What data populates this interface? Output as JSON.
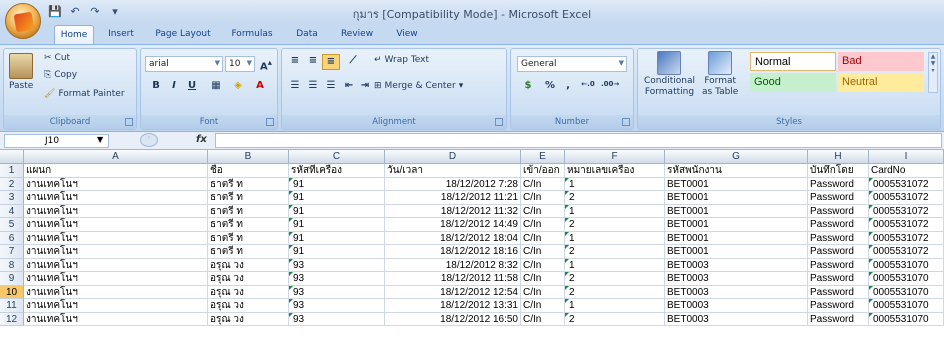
{
  "app": {
    "title": "กุมาร  [Compatibility Mode] - Microsoft Excel"
  },
  "tabs": [
    "Home",
    "Insert",
    "Page Layout",
    "Formulas",
    "Data",
    "Review",
    "View"
  ],
  "ribbon": {
    "clipboard": {
      "label": "Clipboard",
      "paste": "Paste",
      "cut": "Cut",
      "copy": "Copy",
      "format_painter": "Format Painter"
    },
    "font": {
      "label": "Font",
      "name": "arial",
      "size": "10",
      "bold": "B",
      "italic": "I",
      "underline": "U"
    },
    "alignment": {
      "label": "Alignment",
      "wrap_text": "Wrap Text",
      "merge_center": "Merge & Center"
    },
    "number": {
      "label": "Number",
      "format": "General",
      "percent": "%",
      "comma": ","
    },
    "styles": {
      "label": "Styles",
      "conditional": "Conditional",
      "conditional2": "Formatting",
      "format_as": "Format",
      "format_as2": "as Table",
      "normal": "Normal",
      "bad": "Bad",
      "good": "Good",
      "neutral": "Neutral"
    }
  },
  "formula_bar": {
    "name_box": "J10",
    "fx": "fx",
    "value": ""
  },
  "columns": [
    "A",
    "B",
    "C",
    "D",
    "E",
    "F",
    "G",
    "H",
    "I"
  ],
  "rows": [
    {
      "n": "1",
      "cells": [
        "แผนก",
        "ชื่อ",
        "รหัสที่เครื่อง",
        "วัน/เวลา",
        "เข้า/ออก",
        "หมายเลขเครื่อง",
        "รหัสพนักงาน",
        "บันทึกโดย",
        "CardNo"
      ]
    },
    {
      "n": "2",
      "cells": [
        "งานเทคโนฯ",
        "ธาตรี ท",
        "91",
        "18/12/2012 7:28",
        "C/In",
        "1",
        "BET0001",
        "Password",
        "0005531072"
      ]
    },
    {
      "n": "3",
      "cells": [
        "งานเทคโนฯ",
        "ธาตรี ท",
        "91",
        "18/12/2012 11:21",
        "C/In",
        "2",
        "BET0001",
        "Password",
        "0005531072"
      ]
    },
    {
      "n": "4",
      "cells": [
        "งานเทคโนฯ",
        "ธาตรี ท",
        "91",
        "18/12/2012 11:32",
        "C/In",
        "1",
        "BET0001",
        "Password",
        "0005531072"
      ]
    },
    {
      "n": "5",
      "cells": [
        "งานเทคโนฯ",
        "ธาตรี ท",
        "91",
        "18/12/2012 14:49",
        "C/In",
        "2",
        "BET0001",
        "Password",
        "0005531072"
      ]
    },
    {
      "n": "6",
      "cells": [
        "งานเทคโนฯ",
        "ธาตรี ท",
        "91",
        "18/12/2012 18:04",
        "C/In",
        "1",
        "BET0001",
        "Password",
        "0005531072"
      ]
    },
    {
      "n": "7",
      "cells": [
        "งานเทคโนฯ",
        "ธาตรี ท",
        "91",
        "18/12/2012 18:16",
        "C/In",
        "2",
        "BET0001",
        "Password",
        "0005531072"
      ]
    },
    {
      "n": "8",
      "cells": [
        "งานเทคโนฯ",
        "อรุณ วง",
        "93",
        "18/12/2012 8:32",
        "C/In",
        "1",
        "BET0003",
        "Password",
        "0005531070"
      ]
    },
    {
      "n": "9",
      "cells": [
        "งานเทคโนฯ",
        "อรุณ วง",
        "93",
        "18/12/2012 11:58",
        "C/In",
        "2",
        "BET0003",
        "Password",
        "0005531070"
      ]
    },
    {
      "n": "10",
      "cells": [
        "งานเทคโนฯ",
        "อรุณ วง",
        "93",
        "18/12/2012 12:54",
        "C/In",
        "2",
        "BET0003",
        "Password",
        "0005531070"
      ]
    },
    {
      "n": "11",
      "cells": [
        "งานเทคโนฯ",
        "อรุณ วง",
        "93",
        "18/12/2012 13:31",
        "C/In",
        "1",
        "BET0003",
        "Password",
        "0005531070"
      ]
    },
    {
      "n": "12",
      "cells": [
        "งานเทคโนฯ",
        "อรุณ วง",
        "93",
        "18/12/2012 16:50",
        "C/In",
        "2",
        "BET0003",
        "Password",
        "0005531070"
      ]
    }
  ],
  "selected_row": "10"
}
